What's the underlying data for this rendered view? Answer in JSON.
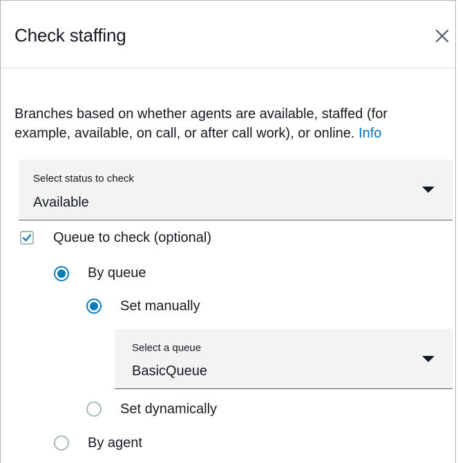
{
  "header": {
    "title": "Check staffing",
    "close_icon": "close-icon"
  },
  "description": {
    "text": "Branches based on whether agents are available, staffed (for example, available, on call, or after call work), or online.",
    "info_link": "Info"
  },
  "status_select": {
    "label": "Select status to check",
    "value": "Available",
    "icon": "caret-down-icon"
  },
  "queue_checkbox": {
    "label": "Queue to check (optional)",
    "checked": true
  },
  "options": {
    "by_queue": {
      "label": "By queue",
      "selected": true
    },
    "set_manually": {
      "label": "Set manually",
      "selected": true
    },
    "set_dynamically": {
      "label": "Set dynamically",
      "selected": false
    },
    "by_agent": {
      "label": "By agent",
      "selected": false
    }
  },
  "queue_select": {
    "label": "Select a queue",
    "value": "BasicQueue",
    "icon": "caret-down-icon"
  },
  "colors": {
    "accent": "#0a7bb8",
    "link": "#0073bb",
    "select_bg": "#f2f3f3",
    "text": "#16191f"
  }
}
